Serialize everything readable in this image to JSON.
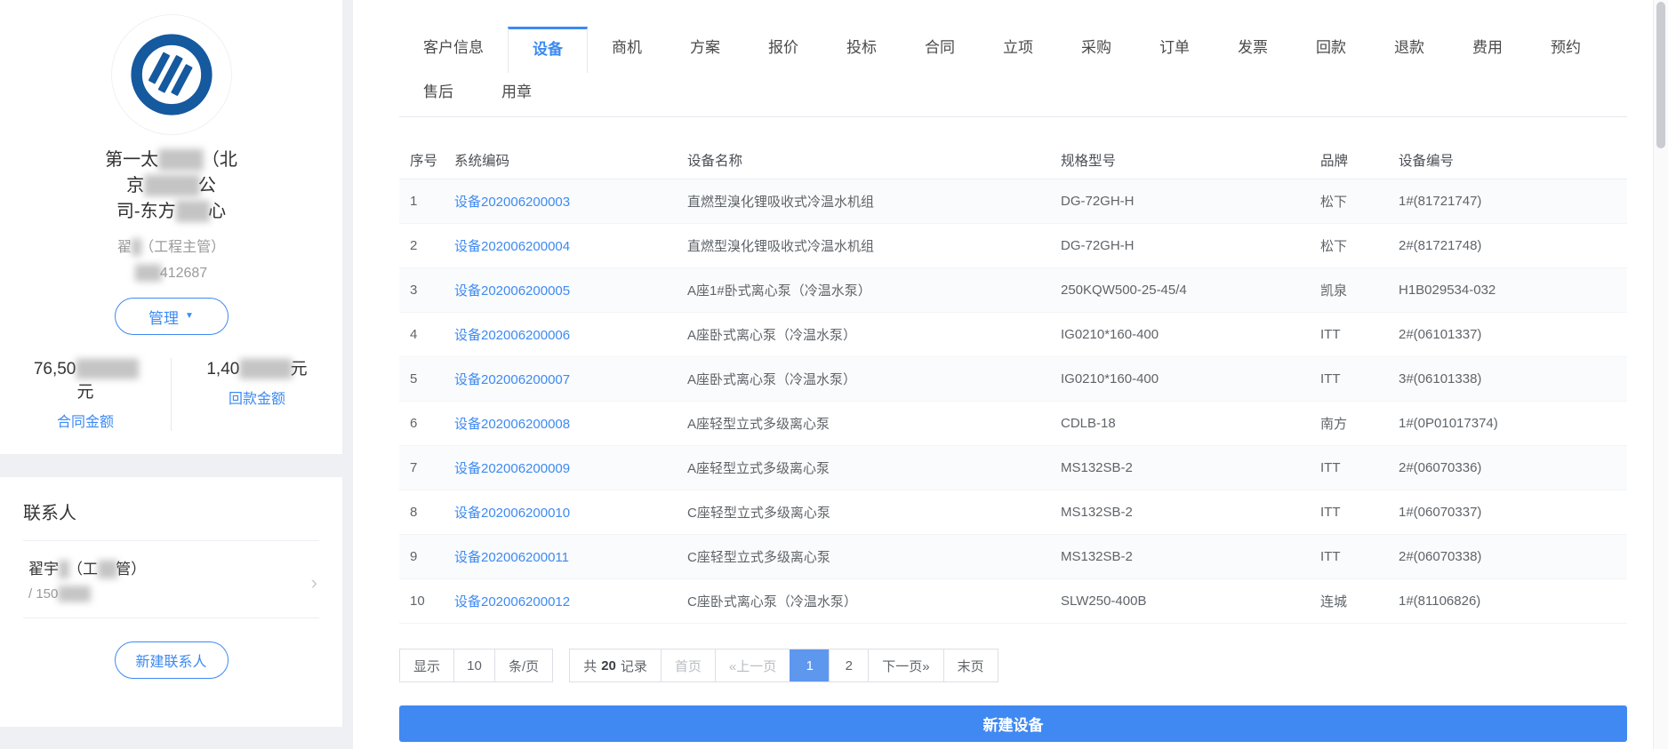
{
  "colors": {
    "accent": "#3d8af2",
    "button_blue": "#4189f2",
    "active_page_bg": "#5e97ee",
    "logo_blue": "#15599f"
  },
  "sidebar": {
    "company_name": {
      "l1a": "第一太",
      "l1r": "████",
      "l1b": "（北",
      "l2a": "京",
      "l2r": "█████",
      "l2b": "公",
      "l3a": "司-东方",
      "l3r": "███",
      "l3b": "心"
    },
    "owner": {
      "a": "翟",
      "r": "█",
      "b": "（工程主管）"
    },
    "phone": {
      "r": "███",
      "b": "412687"
    },
    "manage_button": "管理",
    "stats": {
      "contract": {
        "a": "76,50",
        "r": "██████",
        "unit": "元",
        "label": "合同金额"
      },
      "payment": {
        "a": "1,40",
        "r": "█████",
        "unit": "元",
        "label": "回款金额"
      }
    },
    "contacts": {
      "heading": "联系人",
      "item": {
        "na": "翟宇",
        "nr": "█",
        "nb": "（工",
        "nr2": "██",
        "nc": "管）",
        "pa": "/ 150",
        "pr": "████"
      },
      "new_button": "新建联系人"
    }
  },
  "main": {
    "active_tab": "设备",
    "tabs_row1": [
      {
        "key": "customer-info",
        "label": "客户信息"
      },
      {
        "key": "devices",
        "label": "设备"
      },
      {
        "key": "opportunities",
        "label": "商机"
      },
      {
        "key": "solutions",
        "label": "方案"
      },
      {
        "key": "quotes",
        "label": "报价"
      },
      {
        "key": "bids",
        "label": "投标"
      },
      {
        "key": "contracts",
        "label": "合同"
      },
      {
        "key": "projects",
        "label": "立项"
      },
      {
        "key": "purchasing",
        "label": "采购"
      },
      {
        "key": "orders",
        "label": "订单"
      },
      {
        "key": "invoices",
        "label": "发票"
      },
      {
        "key": "payments",
        "label": "回款"
      },
      {
        "key": "refunds",
        "label": "退款"
      },
      {
        "key": "expenses",
        "label": "费用"
      },
      {
        "key": "appointments",
        "label": "预约"
      }
    ],
    "tabs_row2": [
      {
        "key": "after-sales",
        "label": "售后"
      },
      {
        "key": "seals",
        "label": "用章"
      }
    ],
    "table": {
      "headers": [
        "序号",
        "系统编码",
        "设备名称",
        "规格型号",
        "品牌",
        "设备编号"
      ],
      "rows": [
        [
          "1",
          "设备202006200003",
          "直燃型溴化锂吸收式冷温水机组",
          "DG-72GH-H",
          "松下",
          "1#(81721747)"
        ],
        [
          "2",
          "设备202006200004",
          "直燃型溴化锂吸收式冷温水机组",
          "DG-72GH-H",
          "松下",
          "2#(81721748)"
        ],
        [
          "3",
          "设备202006200005",
          "A座1#卧式离心泵（冷温水泵）",
          "250KQW500-25-45/4",
          "凯泉",
          "H1B029534-032"
        ],
        [
          "4",
          "设备202006200006",
          "A座卧式离心泵（冷温水泵）",
          "IG0210*160-400",
          "ITT",
          "2#(06101337)"
        ],
        [
          "5",
          "设备202006200007",
          "A座卧式离心泵（冷温水泵）",
          "IG0210*160-400",
          "ITT",
          "3#(06101338)"
        ],
        [
          "6",
          "设备202006200008",
          "A座轻型立式多级离心泵",
          "CDLB-18",
          "南方",
          "1#(0P01017374)"
        ],
        [
          "7",
          "设备202006200009",
          "A座轻型立式多级离心泵",
          "MS132SB-2",
          "ITT",
          "2#(06070336)"
        ],
        [
          "8",
          "设备202006200010",
          "C座轻型立式多级离心泵",
          "MS132SB-2",
          "ITT",
          "1#(06070337)"
        ],
        [
          "9",
          "设备202006200011",
          "C座轻型立式多级离心泵",
          "MS132SB-2",
          "ITT",
          "2#(06070338)"
        ],
        [
          "10",
          "设备202006200012",
          "C座卧式离心泵（冷温水泵）",
          "SLW250-400B",
          "连城",
          "1#(81106826)"
        ]
      ]
    },
    "pagination": {
      "show_label": "显示",
      "page_size": "10",
      "per_page_label": "条/页",
      "total_prefix": "共",
      "total": "20",
      "total_suffix": "记录",
      "first": "首页",
      "prev": "«上一页",
      "pages": [
        "1",
        "2"
      ],
      "active_page": "1",
      "next": "下一页»",
      "last": "末页"
    },
    "new_device_button": "新建设备"
  }
}
